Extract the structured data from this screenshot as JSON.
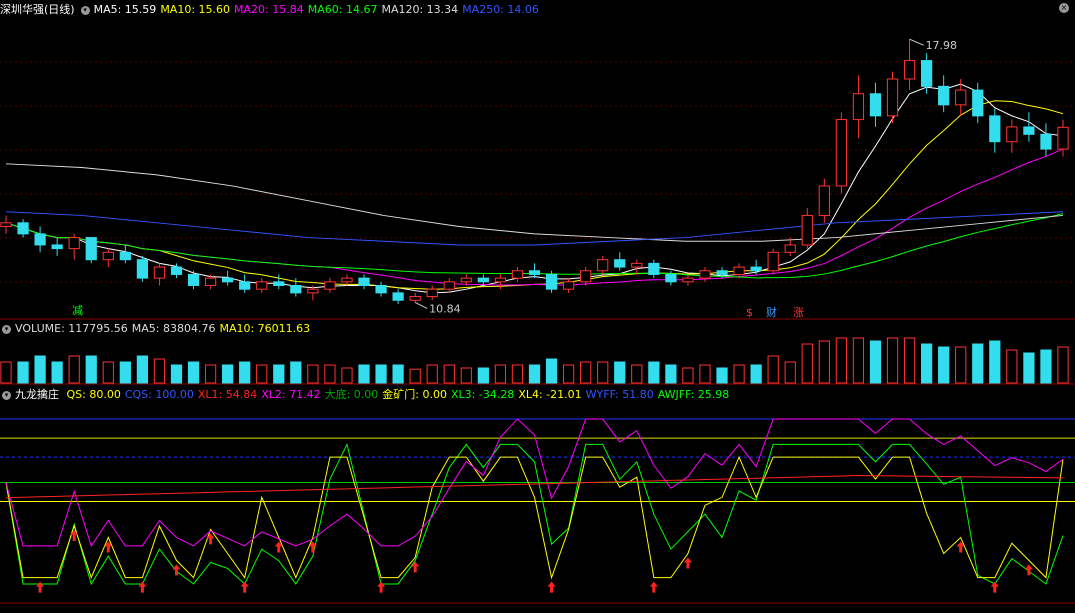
{
  "price_legend": {
    "title": "深圳华强(日线)",
    "items": [
      {
        "text": "MA5: 15.59",
        "color": "#ffffff"
      },
      {
        "text": "MA10: 15.60",
        "color": "#ffff00"
      },
      {
        "text": "MA20: 15.84",
        "color": "#ff00ff"
      },
      {
        "text": "MA60: 14.67",
        "color": "#00ff00"
      },
      {
        "text": "MA120: 13.34",
        "color": "#dddddd"
      },
      {
        "text": "MA250: 14.06",
        "color": "#3355ff"
      }
    ]
  },
  "volume_legend": {
    "items": [
      {
        "text": "VOLUME: 117795.56",
        "color": "#dddddd"
      },
      {
        "text": "MA5: 83804.76",
        "color": "#dddddd"
      },
      {
        "text": "MA10: 76011.63",
        "color": "#ffff00"
      }
    ]
  },
  "indicator_legend": {
    "title": "九龙擒庄",
    "items": [
      {
        "text": "QS: 80.00",
        "color": "#ffff00"
      },
      {
        "text": "CQS: 100.00",
        "color": "#3355ff"
      },
      {
        "text": "XL1: 54.84",
        "color": "#ff2222"
      },
      {
        "text": "XL2: 71.42",
        "color": "#ff00ff"
      },
      {
        "text": "大底: 0.00",
        "color": "#00aa00"
      },
      {
        "text": "金矿门: 0.00",
        "color": "#ffff00"
      },
      {
        "text": "XL3: -34.28",
        "color": "#00ff00"
      },
      {
        "text": "XL4: -21.01",
        "color": "#ffff00"
      },
      {
        "text": "WYFF: 51.80",
        "color": "#3355ff"
      },
      {
        "text": "AWJFF: 25.98",
        "color": "#00ff00"
      }
    ]
  },
  "annotations": {
    "high_label": "17.98",
    "low_label": "10.84",
    "signals": [
      {
        "text": "减",
        "color": "#00ff00"
      },
      {
        "text": "$",
        "color": "#ff3333"
      },
      {
        "text": "财",
        "color": "#3399ff"
      },
      {
        "text": "涨",
        "color": "#ff3333"
      }
    ]
  },
  "chart_data": {
    "type": "candlestick",
    "price": {
      "ohlc_approx": [
        [
          12.9,
          13.2,
          12.7,
          13.0
        ],
        [
          13.0,
          13.1,
          12.6,
          12.7
        ],
        [
          12.7,
          12.9,
          12.2,
          12.4
        ],
        [
          12.4,
          12.6,
          12.1,
          12.3
        ],
        [
          12.3,
          12.7,
          12.0,
          12.6
        ],
        [
          12.6,
          12.6,
          11.9,
          12.0
        ],
        [
          12.0,
          12.3,
          11.8,
          12.2
        ],
        [
          12.2,
          12.4,
          11.9,
          12.0
        ],
        [
          12.0,
          12.1,
          11.4,
          11.5
        ],
        [
          11.5,
          11.9,
          11.3,
          11.8
        ],
        [
          11.8,
          11.9,
          11.5,
          11.6
        ],
        [
          11.6,
          11.7,
          11.2,
          11.3
        ],
        [
          11.3,
          11.6,
          11.2,
          11.5
        ],
        [
          11.5,
          11.7,
          11.3,
          11.4
        ],
        [
          11.4,
          11.6,
          11.1,
          11.2
        ],
        [
          11.2,
          11.5,
          11.1,
          11.4
        ],
        [
          11.4,
          11.6,
          11.2,
          11.3
        ],
        [
          11.3,
          11.5,
          11.0,
          11.1
        ],
        [
          11.1,
          11.3,
          10.9,
          11.2
        ],
        [
          11.2,
          11.5,
          11.1,
          11.4
        ],
        [
          11.4,
          11.6,
          11.3,
          11.5
        ],
        [
          11.5,
          11.6,
          11.2,
          11.3
        ],
        [
          11.3,
          11.4,
          11.0,
          11.1
        ],
        [
          11.1,
          11.2,
          10.8,
          10.9
        ],
        [
          10.9,
          11.1,
          10.84,
          11.0
        ],
        [
          11.0,
          11.3,
          10.9,
          11.2
        ],
        [
          11.2,
          11.5,
          11.1,
          11.4
        ],
        [
          11.4,
          11.6,
          11.3,
          11.5
        ],
        [
          11.5,
          11.6,
          11.3,
          11.4
        ],
        [
          11.4,
          11.6,
          11.2,
          11.5
        ],
        [
          11.5,
          11.8,
          11.4,
          11.7
        ],
        [
          11.7,
          11.9,
          11.5,
          11.6
        ],
        [
          11.6,
          11.7,
          11.1,
          11.2
        ],
        [
          11.2,
          11.5,
          11.1,
          11.4
        ],
        [
          11.4,
          11.8,
          11.3,
          11.7
        ],
        [
          11.7,
          12.1,
          11.6,
          12.0
        ],
        [
          12.0,
          12.2,
          11.7,
          11.8
        ],
        [
          11.8,
          12.0,
          11.6,
          11.9
        ],
        [
          11.9,
          12.0,
          11.5,
          11.6
        ],
        [
          11.6,
          11.7,
          11.3,
          11.4
        ],
        [
          11.4,
          11.6,
          11.3,
          11.5
        ],
        [
          11.5,
          11.8,
          11.4,
          11.7
        ],
        [
          11.7,
          11.8,
          11.5,
          11.6
        ],
        [
          11.6,
          11.9,
          11.5,
          11.8
        ],
        [
          11.8,
          12.0,
          11.6,
          11.7
        ],
        [
          11.7,
          12.3,
          11.6,
          12.2
        ],
        [
          12.2,
          12.6,
          12.1,
          12.4
        ],
        [
          12.4,
          13.4,
          12.3,
          13.2
        ],
        [
          13.2,
          14.2,
          13.0,
          14.0
        ],
        [
          14.0,
          16.0,
          13.8,
          15.8
        ],
        [
          15.8,
          17.0,
          15.3,
          16.5
        ],
        [
          16.5,
          16.8,
          15.6,
          15.9
        ],
        [
          15.9,
          17.1,
          15.7,
          16.9
        ],
        [
          16.9,
          17.98,
          16.6,
          17.4
        ],
        [
          17.4,
          17.6,
          16.5,
          16.7
        ],
        [
          16.7,
          17.0,
          16.0,
          16.2
        ],
        [
          16.2,
          16.9,
          15.9,
          16.6
        ],
        [
          16.6,
          16.8,
          15.7,
          15.9
        ],
        [
          15.9,
          16.1,
          14.9,
          15.2
        ],
        [
          15.2,
          15.8,
          14.9,
          15.6
        ],
        [
          15.6,
          16.0,
          15.2,
          15.4
        ],
        [
          15.4,
          15.7,
          14.8,
          15.0
        ],
        [
          15.0,
          15.8,
          14.8,
          15.59
        ]
      ],
      "high": 17.98,
      "low": 10.84,
      "ylim": [
        10.5,
        18.5
      ]
    },
    "volume": {
      "latest": 117795.56,
      "ma5": 83804.76,
      "ma10": 76011.63
    },
    "indicator": {
      "ylim": [
        -45,
        115
      ],
      "reference_levels": [
        {
          "value": 100,
          "color": "#2233ff",
          "style": "solid"
        },
        {
          "value": 85,
          "color": "#dddd00",
          "style": "solid"
        },
        {
          "value": 70,
          "color": "#2233ff",
          "style": "dashed"
        },
        {
          "value": 50,
          "color": "#00cc00",
          "style": "solid"
        },
        {
          "value": 35,
          "color": "#ffff00",
          "style": "solid"
        }
      ]
    }
  }
}
